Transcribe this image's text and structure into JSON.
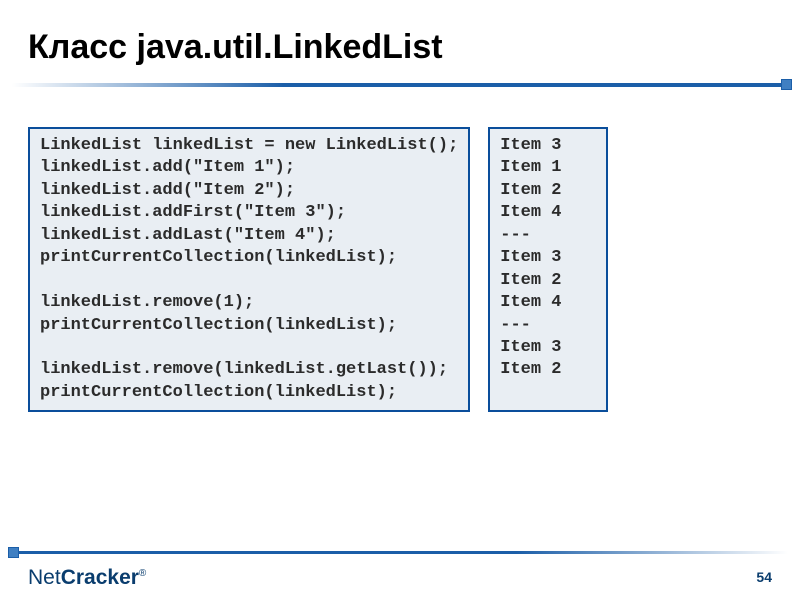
{
  "title": "Класс java.util.LinkedList",
  "code": "LinkedList linkedList = new LinkedList();\nlinkedList.add(\"Item 1\");\nlinkedList.add(\"Item 2\");\nlinkedList.addFirst(\"Item 3\");\nlinkedList.addLast(\"Item 4\");\nprintCurrentCollection(linkedList);\n\nlinkedList.remove(1);\nprintCurrentCollection(linkedList);\n\nlinkedList.remove(linkedList.getLast());\nprintCurrentCollection(linkedList);",
  "output": "Item 3\nItem 1\nItem 2\nItem 4\n---\nItem 3\nItem 2\nItem 4\n---\nItem 3\nItem 2",
  "logo": {
    "part1": "Net",
    "part2": "Cracker",
    "reg": "®"
  },
  "page_number": "54"
}
